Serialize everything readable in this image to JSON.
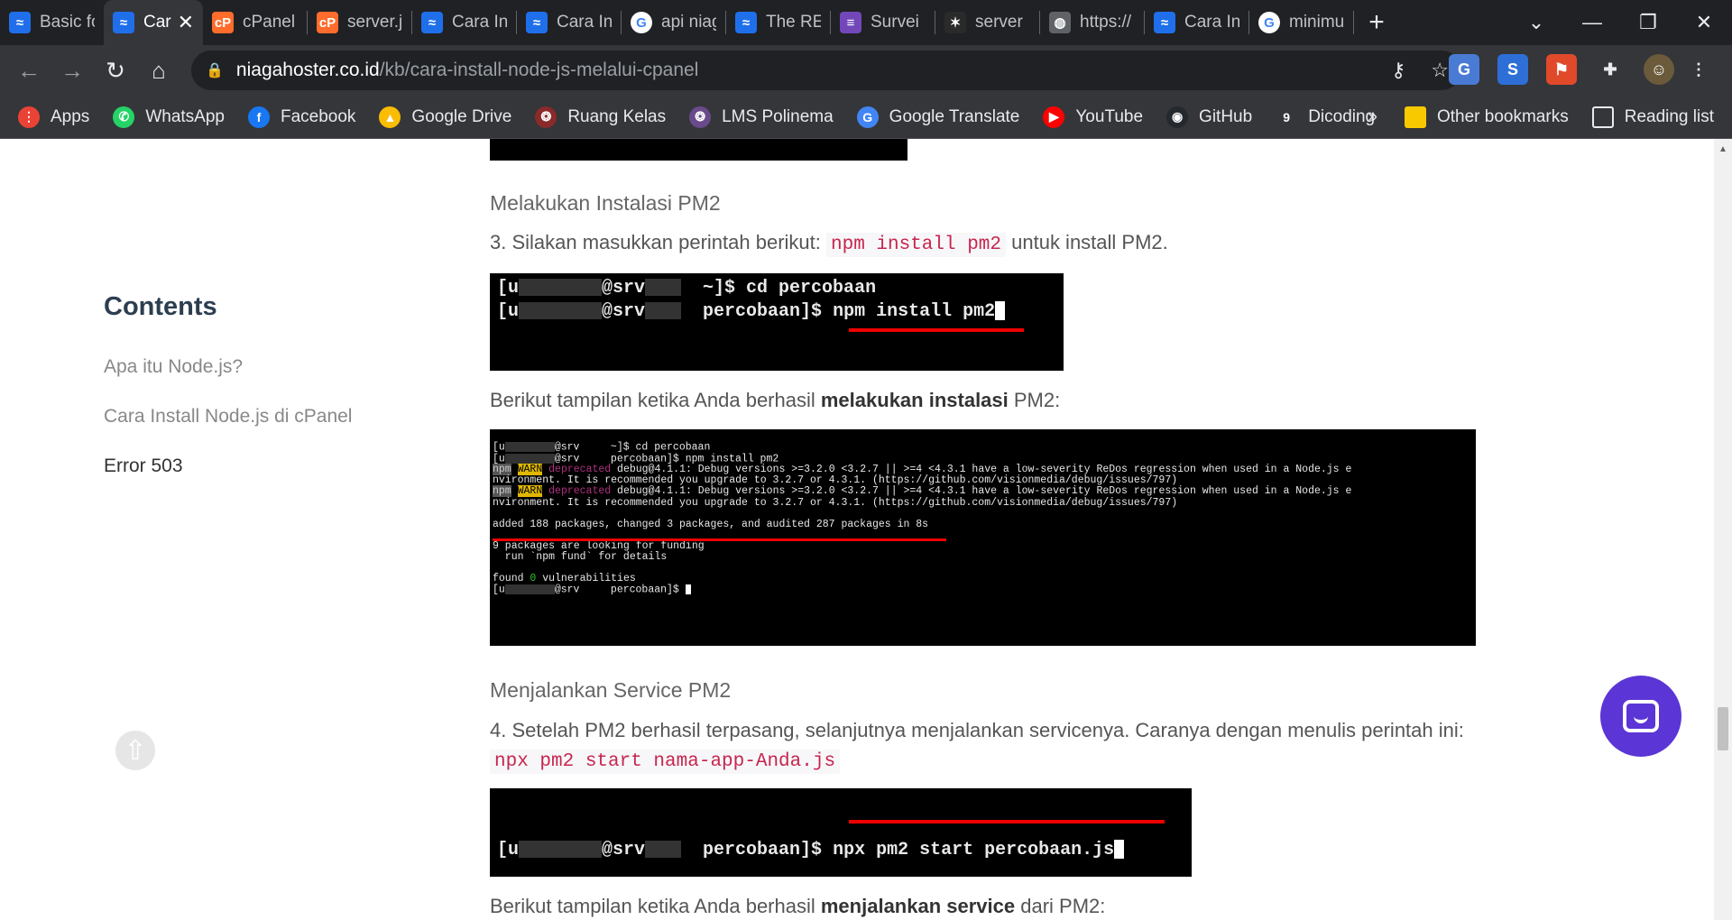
{
  "tabs": [
    {
      "title": "Basic fo",
      "favicon": "niagahoster-icon",
      "color": "#1f6feb",
      "glyph": "≈"
    },
    {
      "title": "Car",
      "favicon": "niagahoster-icon",
      "color": "#1f6feb",
      "glyph": "≈",
      "active": true
    },
    {
      "title": "cPanel",
      "favicon": "cpanel-icon",
      "color": "#ff6c2c",
      "glyph": "cP"
    },
    {
      "title": "server.j",
      "favicon": "cpanel-icon",
      "color": "#ff6c2c",
      "glyph": "cP"
    },
    {
      "title": "Cara In",
      "favicon": "niagahoster-icon",
      "color": "#1f6feb",
      "glyph": "≈"
    },
    {
      "title": "Cara In",
      "favicon": "niagahoster-icon",
      "color": "#1f6feb",
      "glyph": "≈"
    },
    {
      "title": "api niag",
      "favicon": "google-icon",
      "color": "#ffffff",
      "glyph": "G"
    },
    {
      "title": "The RE",
      "favicon": "niagahoster-icon",
      "color": "#1f6feb",
      "glyph": "≈"
    },
    {
      "title": "Survei",
      "favicon": "forms-icon",
      "color": "#7248b9",
      "glyph": "≡"
    },
    {
      "title": "server",
      "favicon": "spark-icon",
      "color": "#2a2a2a",
      "glyph": "✶"
    },
    {
      "title": "https://",
      "favicon": "globe-icon",
      "color": "#5f6368",
      "glyph": "◍"
    },
    {
      "title": "Cara In",
      "favicon": "niagahoster-icon",
      "color": "#1f6feb",
      "glyph": "≈"
    },
    {
      "title": "minimu",
      "favicon": "google-icon",
      "color": "#ffffff",
      "glyph": "G"
    }
  ],
  "toolbar": {
    "url_host": "niagahoster.co.id",
    "url_path": "/kb/cara-install-node-js-melalui-cpanel"
  },
  "bookmarks": [
    {
      "label": "Apps",
      "icon": "apps-grid-icon",
      "color": "#ea4335",
      "glyph": "⋮"
    },
    {
      "label": "WhatsApp",
      "icon": "whatsapp-icon",
      "color": "#25d366",
      "glyph": "✆"
    },
    {
      "label": "Facebook",
      "icon": "facebook-icon",
      "color": "#1877f2",
      "glyph": "f"
    },
    {
      "label": "Google Drive",
      "icon": "google-drive-icon",
      "color": "#fbbc04",
      "glyph": "▲"
    },
    {
      "label": "Ruang Kelas",
      "icon": "ruang-kelas-icon",
      "color": "#8a2a2a",
      "glyph": "❂"
    },
    {
      "label": "LMS Polinema",
      "icon": "lms-polinema-icon",
      "color": "#6a4a8a",
      "glyph": "❂"
    },
    {
      "label": "Google Translate",
      "icon": "google-translate-icon",
      "color": "#4285f4",
      "glyph": "G"
    },
    {
      "label": "YouTube",
      "icon": "youtube-icon",
      "color": "#ff0000",
      "glyph": "▶"
    },
    {
      "label": "GitHub",
      "icon": "github-icon",
      "color": "#24292e",
      "glyph": "◉"
    },
    {
      "label": "Dicoding",
      "icon": "dicoding-icon",
      "color": "#35363a",
      "glyph": "9"
    }
  ],
  "bookmarks_right": {
    "overflow": "»",
    "other": "Other bookmarks",
    "reading": "Reading list"
  },
  "toc": {
    "title": "Contents",
    "items": [
      "Apa itu Node.js?",
      "Cara Install Node.js di cPanel",
      "Error 503"
    ]
  },
  "article": {
    "h_install": "Melakukan Instalasi PM2",
    "step3_pre": "3. Silakan masukkan perintah berikut: ",
    "step3_code": "npm install pm2",
    "step3_post": " untuk install PM2.",
    "success_install_pre": "Berikut tampilan ketika Anda berhasil ",
    "success_install_bold": "melakukan instalasi",
    "success_install_post": " PM2:",
    "h_service": "Menjalankan Service PM2",
    "step4": "4. Setelah PM2 berhasil terpasang, selanjutnya menjalankan servicenya. Caranya dengan menulis perintah ini:",
    "step4_code": "npx pm2 start nama-app-Anda.js",
    "success_service_pre": "Berikut tampilan ketika Anda berhasil ",
    "success_service_bold": "menjalankan service",
    "success_service_post": " dari PM2:"
  },
  "term1": {
    "l1_a": "[u",
    "l1_b": "@srv",
    "l1_c": "  ~]$ cd percobaan",
    "l2_a": "[u",
    "l2_b": "@srv",
    "l2_c": "  percobaan]$ ",
    "l2_cmd": "npm install pm2"
  },
  "term2": {
    "l1": "@srv     ~]$ cd percobaan",
    "l2": "@srv     percobaan]$ npm install pm2",
    "npm": "npm",
    "warn": "WARN",
    "deprecated": "deprecated",
    "warn1a": " debug@4.1.1: Debug versions >=3.2.0 <3.2.7 || >=4 <4.3.1 have a low-severity ReDos regression when used in a Node.js e",
    "warn1b": "nvironment. It is recommended you upgrade to 3.2.7 or 4.3.1. (https://github.com/visionmedia/debug/issues/797)",
    "added": "added 188 packages, changed 3 packages, and audited 287 packages",
    "added_time": " in 8s",
    "funding1": "9 packages are looking for funding",
    "funding2": "  run `npm fund` for details",
    "vuln_pre": "found ",
    "vuln_n": "0",
    "vuln_post": " vulnerabilities",
    "last": "@srv     percobaan]$ "
  },
  "term3": {
    "a": "[u",
    "b": "@srv",
    "c": "  percobaan]$ ",
    "cmd": "npx pm2 start percobaan.js"
  }
}
